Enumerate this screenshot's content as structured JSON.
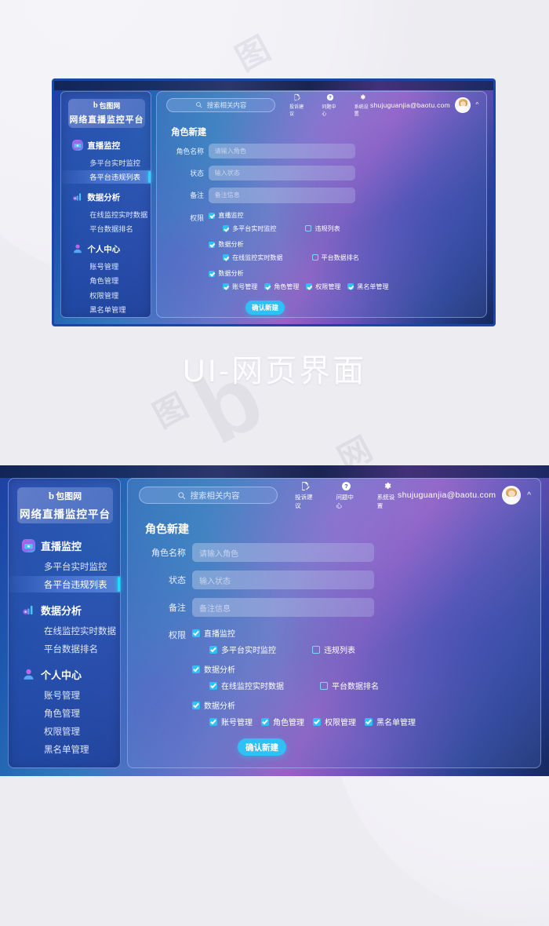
{
  "page": {
    "caption": "UI-网页界面",
    "watermark": "包图网",
    "background_color": "#edecf1"
  },
  "app": {
    "logo": {
      "brand_mark": "b",
      "brand_name": "包图网",
      "platform_name": "网络直播监控平台"
    },
    "search": {
      "placeholder": "搜索相关内容",
      "icon": "search-icon"
    },
    "topbar_actions": [
      {
        "icon": "feedback-icon",
        "label": "投诉建议"
      },
      {
        "icon": "question-icon",
        "label": "问题中心"
      },
      {
        "icon": "gear-icon",
        "label": "系统设置"
      }
    ],
    "user": {
      "email": "shujuguanjia@baotu.com",
      "avatar": "user-avatar",
      "chevron": "^"
    },
    "sidebar": {
      "groups": [
        {
          "icon": "monitor-icon",
          "label": "直播监控",
          "items": [
            {
              "label": "多平台实时监控",
              "active": false
            },
            {
              "label": "各平台违规列表",
              "active": true
            }
          ]
        },
        {
          "icon": "analytics-icon",
          "label": "数据分析",
          "items": [
            {
              "label": "在线监控实时数据",
              "active": false
            },
            {
              "label": "平台数据排名",
              "active": false
            }
          ]
        },
        {
          "icon": "user-icon",
          "label": "个人中心",
          "items": [
            {
              "label": "账号管理",
              "active": false
            },
            {
              "label": "角色管理",
              "active": false
            },
            {
              "label": "权限管理",
              "active": false
            },
            {
              "label": "黑名单管理",
              "active": false
            }
          ]
        }
      ]
    },
    "form": {
      "title": "角色新建",
      "fields": [
        {
          "label": "角色名称",
          "value": "",
          "placeholder": "请输入角色"
        },
        {
          "label": "状态",
          "value": "",
          "placeholder": "输入状态"
        },
        {
          "label": "备注",
          "value": "",
          "placeholder": "备注信息"
        }
      ],
      "permissions_label": "权限",
      "permission_rows": [
        {
          "parent": {
            "label": "直播监控",
            "checked": true
          },
          "children": [
            {
              "label": "多平台实时监控",
              "checked": true
            },
            {
              "label": "违规列表",
              "checked": false
            }
          ]
        },
        {
          "parent": {
            "label": "数据分析",
            "checked": true
          },
          "children": [
            {
              "label": "在线监控实时数据",
              "checked": true
            },
            {
              "label": "平台数据排名",
              "checked": false
            }
          ]
        },
        {
          "parent": {
            "label": "数据分析",
            "checked": true
          },
          "children": [
            {
              "label": "账号管理",
              "checked": true
            },
            {
              "label": "角色管理",
              "checked": true
            },
            {
              "label": "权限管理",
              "checked": true
            },
            {
              "label": "黑名单管理",
              "checked": true
            }
          ]
        }
      ],
      "submit_label": "确认新建"
    },
    "colors": {
      "accent_cyan": "#2fc0f5",
      "active_nav_bar": "#22d8ff",
      "panel_border": "#b9d2ff"
    }
  }
}
